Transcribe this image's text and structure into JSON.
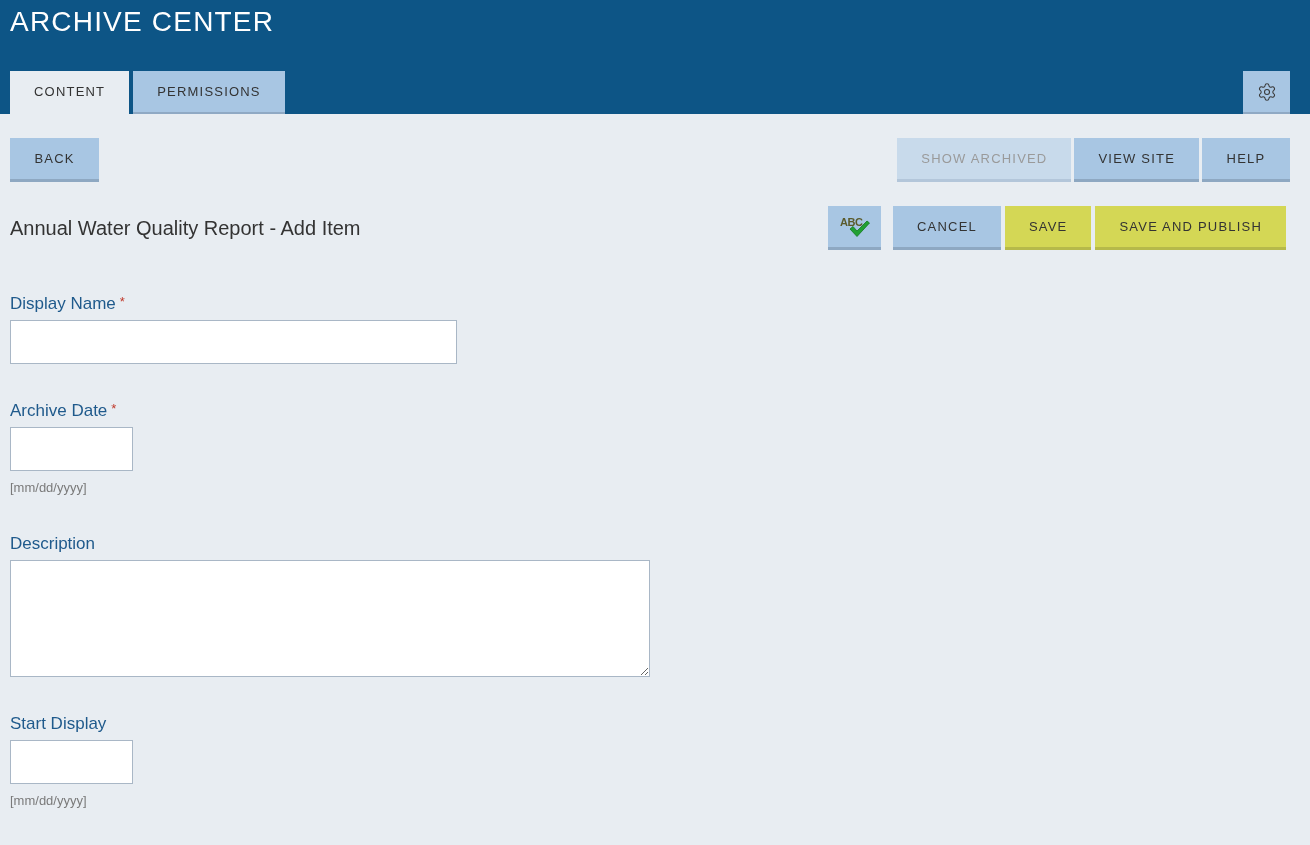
{
  "header": {
    "title": "ARCHIVE CENTER",
    "tabs": [
      {
        "label": "CONTENT",
        "selected": true
      },
      {
        "label": "PERMISSIONS",
        "selected": false
      }
    ]
  },
  "toolbar": {
    "left": [
      {
        "label": "BACK",
        "disabled": false
      }
    ],
    "right": [
      {
        "label": "SHOW ARCHIVED",
        "disabled": true
      },
      {
        "label": "VIEW SITE",
        "disabled": false
      },
      {
        "label": "HELP",
        "disabled": false
      }
    ]
  },
  "page": {
    "title": "Annual Water Quality Report - Add Item",
    "actions": [
      {
        "kind": "spellcheck",
        "label": "ABC"
      },
      {
        "kind": "plain",
        "label": "CANCEL"
      },
      {
        "kind": "accent",
        "label": "SAVE"
      },
      {
        "kind": "accent",
        "label": "SAVE AND PUBLISH"
      }
    ]
  },
  "form": {
    "fields": [
      {
        "kind": "text",
        "label": "Display Name",
        "required_mark": "*"
      },
      {
        "kind": "date",
        "label": "Archive Date",
        "required_mark": "*",
        "hint": "[mm/dd/yyyy]"
      },
      {
        "kind": "textarea",
        "label": "Description"
      },
      {
        "kind": "date",
        "label": "Start Display",
        "hint": "[mm/dd/yyyy]"
      }
    ]
  }
}
